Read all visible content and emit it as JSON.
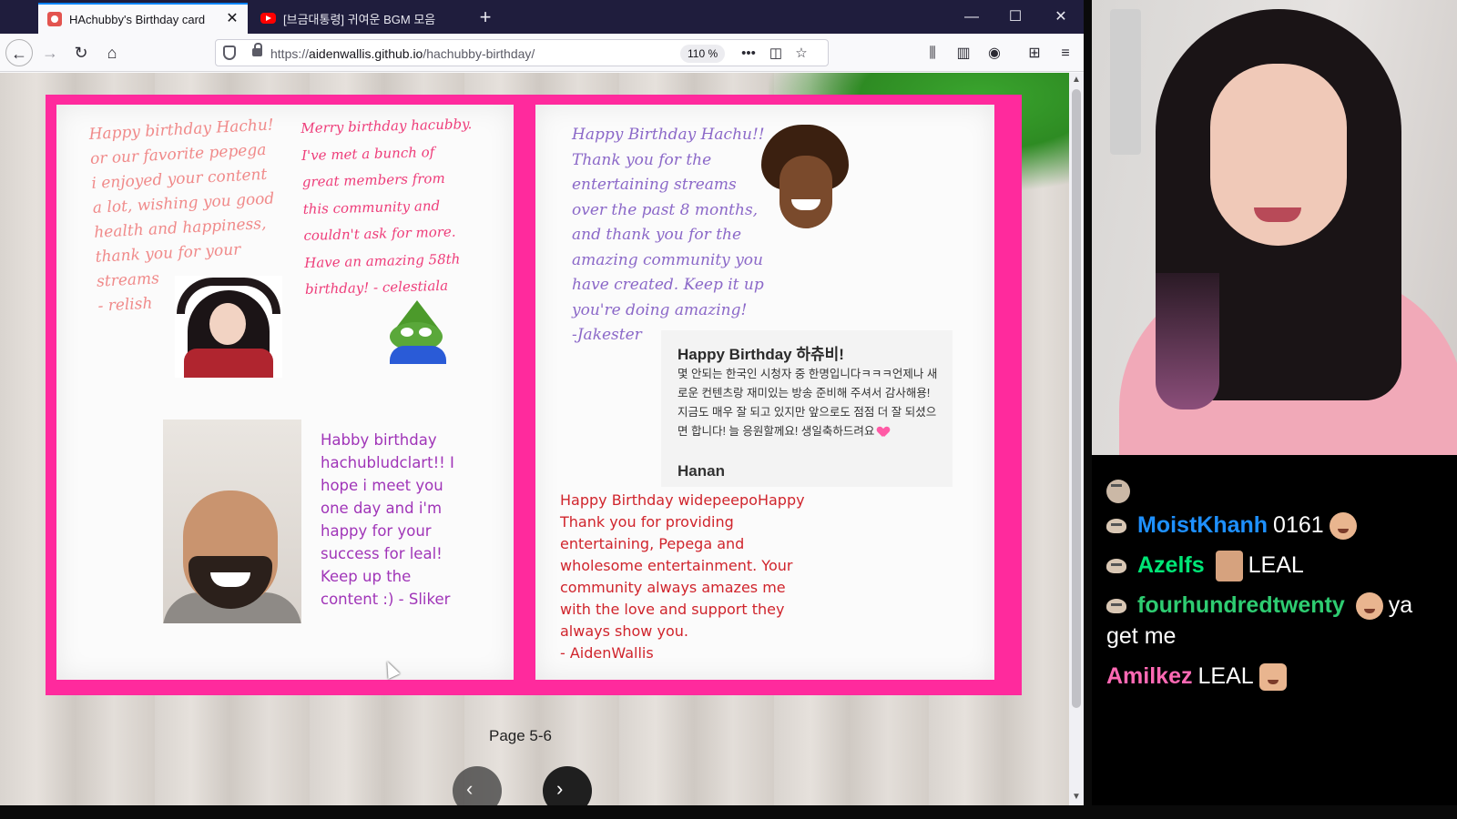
{
  "browser": {
    "tabs": [
      {
        "title": "HAchubby's Birthday card",
        "active": true,
        "icon": "birthday-card-favicon"
      },
      {
        "title": "[브금대통령] 귀여운 BGM 모음",
        "active": false,
        "icon": "youtube-favicon"
      }
    ],
    "url_prefix": "https://",
    "url_domain": "aidenwallis.github.io",
    "url_path": "/hachubby-birthday/",
    "zoom": "110 %",
    "tab_close_glyph": "✕",
    "new_tab_glyph": "+",
    "window_controls": {
      "minimize": "—",
      "maximize": "☐",
      "close": "✕"
    },
    "nav": {
      "back": "←",
      "forward": "→",
      "reload": "↻",
      "home": "⌂"
    },
    "url_icons": {
      "more": "•••",
      "pocket": "◫",
      "bookmark": "☆"
    },
    "toolbar_icons": {
      "library": "⫼",
      "sidebar": "▥",
      "account": "◉",
      "extensions": "⊞",
      "menu": "≡"
    }
  },
  "card": {
    "left_page": {
      "relish_message": "Happy birthday Hachu!\nor our favorite pepega\ni enjoyed your content\na lot, wishing you good\nhealth and happiness,\nthank you for your\nstreams\n- relish",
      "celestial_message": "Merry birthday hacubby.\nI've met a bunch of\ngreat members from\nthis community and\ncouldn't ask for more.\nHave an amazing 58th\nbirthday! - celestiala",
      "sliker_message": "Habby birthday\nhachubludclart!! I\nhope i meet you\none day and i'm\nhappy for your\nsuccess for leal!\nKeep up the\ncontent :) - Sliker"
    },
    "right_page": {
      "jakester_message": "Happy Birthday Hachu!!\nThank you for the\nentertaining streams\nover the past 8 months,\nand thank you for the\namazing community you\nhave created. Keep it up\nyou're doing amazing!\n-Jakester",
      "hanan_title": "Happy Birthday 하츄비!",
      "hanan_body": "몇 안되는 한국인 시청자 중 한명입니다ㅋㅋㅋ언제나 새로운 컨텐츠랑 재미있는 방송 준비해 주셔서 감사해용! 지금도 매우 잘 되고 있지만 앞으로도 점점 더 잘 되셨으면 합니다! 늘 응원할께요! 생일축하드려요",
      "hanan_sign": "Hanan",
      "aiden_message": "Happy Birthday widepeepoHappy\nThank you for providing\nentertaining, Pepega and\nwholesome entertainment. Your\ncommunity always amazes me\nwith the love and support  they\nalways show you.\n- AidenWallis"
    }
  },
  "pagination": {
    "label": "Page 5-6",
    "prev": "‹",
    "next": "›"
  },
  "chat": {
    "messages": [
      {
        "user": "",
        "color": "#ffffff",
        "text": ""
      },
      {
        "user": "MoistKhanh",
        "color": "#1e90ff",
        "text": "0161"
      },
      {
        "user": "Azelfs",
        "color": "#00e676",
        "text": "LEAL"
      },
      {
        "user": "fourhundredtwenty",
        "color": "#2ecc71",
        "text": "ya get me"
      },
      {
        "user": "Amilkez",
        "color": "#ff69b4",
        "text": "LEAL"
      }
    ]
  },
  "colors": {
    "card_border": "#ff2a9d",
    "tab_bar": "#1f1d3d",
    "accent": "#0a84ff"
  }
}
